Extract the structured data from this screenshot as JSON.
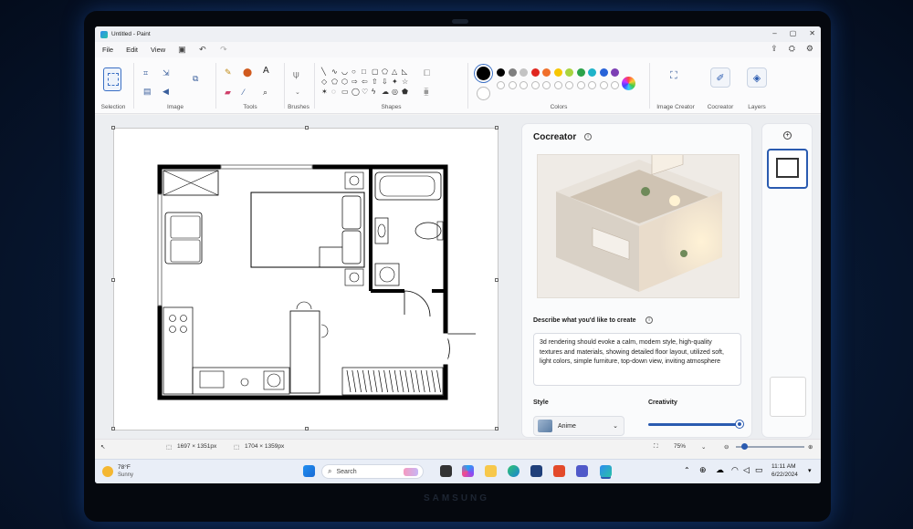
{
  "window": {
    "title": "Untitled - Paint"
  },
  "menu": [
    "File",
    "Edit",
    "View"
  ],
  "ribbon": {
    "groups": [
      "Selection",
      "Image",
      "Tools",
      "Brushes",
      "Shapes",
      "Colors",
      "Image Creator",
      "Cocreator",
      "Layers"
    ],
    "palette_row1": [
      "#000000",
      "#7f7f7f",
      "#c3c3c3",
      "#e0261f",
      "#f0702b",
      "#f7c600",
      "#a8d43f",
      "#2ca34a",
      "#1fb3c9",
      "#2863d8",
      "#7d3fb5"
    ],
    "palette_row2": [
      "#ffffff",
      "#c3c3c3",
      "#dcdcdc",
      "#f4a3b7",
      "#f9c89b",
      "#fce9a0",
      "#dff0b6",
      "#b8e4c2",
      "#b7e8f0",
      "#b8c8f0",
      "#d8c1ea"
    ]
  },
  "cocreator": {
    "title": "Cocreator",
    "describe_label": "Describe what you'd like to create",
    "prompt": "3d rendering should evoke a calm, modern style, high-quality textures and materials, showing detailed floor layout, utilized soft, light colors, simple furniture, top-down view, inviting atmosphere",
    "style_label": "Style",
    "style_value": "Anime",
    "creativity_label": "Creativity",
    "creativity_level": 1.0
  },
  "status": {
    "selection_size": "1697 × 1351px",
    "canvas_size": "1704 × 1359px",
    "zoom": "75%"
  },
  "taskbar": {
    "weather_temp": "78°F",
    "weather_cond": "Sunny",
    "search_placeholder": "Search",
    "time": "11:11 AM",
    "date": "6/22/2024"
  },
  "brand": "SAMSUNG"
}
